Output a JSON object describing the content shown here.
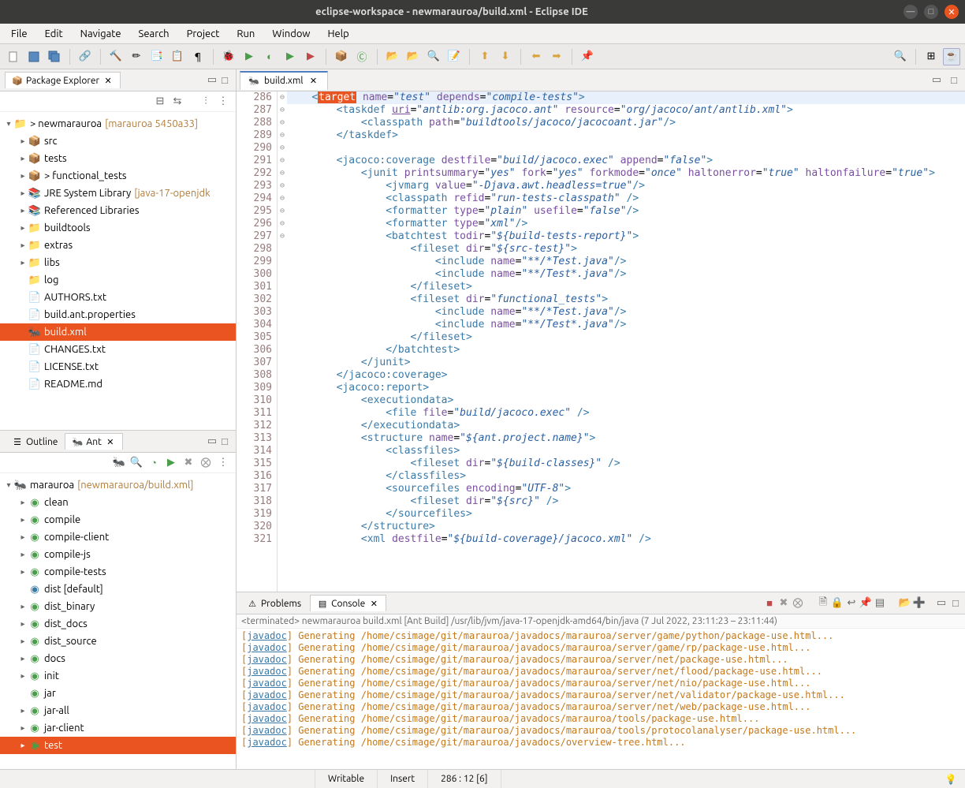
{
  "window": {
    "title": "eclipse-workspace - newmarauroa/build.xml - Eclipse IDE"
  },
  "menu": [
    "File",
    "Edit",
    "Navigate",
    "Search",
    "Project",
    "Run",
    "Window",
    "Help"
  ],
  "pkgExplorer": {
    "title": "Package Explorer",
    "project": {
      "name": "> newmarauroa",
      "suffix": "[marauroa 5450a33]"
    },
    "items": [
      {
        "indent": 1,
        "tw": "▸",
        "icon": "pkg",
        "label": "src"
      },
      {
        "indent": 1,
        "tw": "▸",
        "icon": "pkg",
        "label": "tests"
      },
      {
        "indent": 1,
        "tw": "▸",
        "icon": "pkg",
        "label": "> functional_tests"
      },
      {
        "indent": 1,
        "tw": "▸",
        "icon": "jar",
        "label": "JRE System Library",
        "suffix": "[java-17-openjdk"
      },
      {
        "indent": 1,
        "tw": "▸",
        "icon": "jar",
        "label": "Referenced Libraries"
      },
      {
        "indent": 1,
        "tw": "▸",
        "icon": "folder",
        "label": "buildtools"
      },
      {
        "indent": 1,
        "tw": "▸",
        "icon": "folder",
        "label": "extras"
      },
      {
        "indent": 1,
        "tw": "▸",
        "icon": "folder",
        "label": "libs"
      },
      {
        "indent": 1,
        "tw": "",
        "icon": "folder",
        "label": "log"
      },
      {
        "indent": 1,
        "tw": "",
        "icon": "file",
        "label": "AUTHORS.txt"
      },
      {
        "indent": 1,
        "tw": "",
        "icon": "file",
        "label": "build.ant.properties"
      },
      {
        "indent": 1,
        "tw": "",
        "icon": "ant",
        "label": "build.xml",
        "selected": true
      },
      {
        "indent": 1,
        "tw": "",
        "icon": "file",
        "label": "CHANGES.txt"
      },
      {
        "indent": 1,
        "tw": "",
        "icon": "file",
        "label": "LICENSE.txt"
      },
      {
        "indent": 1,
        "tw": "",
        "icon": "file",
        "label": "README.md"
      }
    ]
  },
  "outline": {
    "tab1": "Outline",
    "tab2": "Ant"
  },
  "ant": {
    "root": {
      "name": "marauroa",
      "suffix": "[newmarauroa/build.xml]"
    },
    "targets": [
      "clean",
      "compile",
      "compile-client",
      "compile-js",
      "compile-tests",
      "dist [default]",
      "dist_binary",
      "dist_docs",
      "dist_source",
      "docs",
      "init",
      "jar",
      "jar-all",
      "jar-client",
      "test"
    ],
    "selectedTarget": "test"
  },
  "editor": {
    "file": "build.xml",
    "startLine": 286,
    "lines": [
      {
        "n": 286,
        "fold": "⊖",
        "current": true,
        "html": "    <span class='tagc'>&lt;</span><span class='hl-target'>target</span> <span class='attr'>name</span>=<span class='val'>\"test\"</span> <span class='attr'>depends</span>=<span class='val'>\"compile-tests\"</span><span class='tagc'>&gt;</span>"
      },
      {
        "n": 287,
        "fold": "⊖",
        "html": "        <span class='tagc'>&lt;taskdef</span> <span class='attr'><u>uri</u></span>=<span class='val'>\"antlib:org.jacoco.ant\"</span> <span class='attr'>resource</span>=<span class='val'>\"org/jacoco/ant/antlib.xml\"</span><span class='tagc'>&gt;</span>"
      },
      {
        "n": 288,
        "fold": "",
        "html": "            <span class='tagc'>&lt;classpath</span> <span class='attr'>path</span>=<span class='val'>\"buildtools/jacoco/jacocoant.jar\"</span><span class='tagc'>/&gt;</span>"
      },
      {
        "n": 289,
        "fold": "",
        "html": "        <span class='tagc'>&lt;/taskdef&gt;</span>"
      },
      {
        "n": 290,
        "fold": "",
        "html": ""
      },
      {
        "n": 291,
        "fold": "⊖",
        "html": "        <span class='tagc'>&lt;jacoco:coverage</span> <span class='attr'>destfile</span>=<span class='val'>\"build/jacoco.exec\"</span> <span class='attr'>append</span>=<span class='val'>\"false\"</span><span class='tagc'>&gt;</span>"
      },
      {
        "n": 292,
        "fold": "⊖",
        "html": "            <span class='tagc'>&lt;junit</span> <span class='attr'>printsummary</span>=<span class='val'>\"yes\"</span> <span class='attr'>fork</span>=<span class='val'>\"yes\"</span> <span class='attr'>forkmode</span>=<span class='val'>\"once\"</span> <span class='attr'>haltonerror</span>=<span class='val'>\"true\"</span> <span class='attr'>haltonfailure</span>=<span class='val'>\"true\"</span><span class='tagc'>&gt;</span>"
      },
      {
        "n": 293,
        "fold": "",
        "html": "                <span class='tagc'>&lt;jvmarg</span> <span class='attr'>value</span>=<span class='val'>\"-Djava.awt.headless=true\"</span><span class='tagc'>/&gt;</span>"
      },
      {
        "n": 294,
        "fold": "",
        "html": "                <span class='tagc'>&lt;classpath</span> <span class='attr'>refid</span>=<span class='val'>\"run-tests-classpath\"</span> <span class='tagc'>/&gt;</span>"
      },
      {
        "n": 295,
        "fold": "",
        "html": "                <span class='tagc'>&lt;formatter</span> <span class='attr'>type</span>=<span class='val'>\"plain\"</span> <span class='attr'>usefile</span>=<span class='val'>\"false\"</span><span class='tagc'>/&gt;</span>"
      },
      {
        "n": 296,
        "fold": "",
        "html": "                <span class='tagc'>&lt;formatter</span> <span class='attr'>type</span>=<span class='val'>\"xml\"</span><span class='tagc'>/&gt;</span>"
      },
      {
        "n": 297,
        "fold": "⊖",
        "html": "                <span class='tagc'>&lt;batchtest</span> <span class='attr'>todir</span>=<span class='val'>\"${build-tests-report}\"</span><span class='tagc'>&gt;</span>"
      },
      {
        "n": 298,
        "fold": "⊖",
        "html": "                    <span class='tagc'>&lt;fileset</span> <span class='attr'>dir</span>=<span class='val'>\"${src-test}\"</span><span class='tagc'>&gt;</span>"
      },
      {
        "n": 299,
        "fold": "",
        "html": "                        <span class='tagc'>&lt;include</span> <span class='attr'>name</span>=<span class='val'>\"**/*Test.java\"</span><span class='tagc'>/&gt;</span>"
      },
      {
        "n": 300,
        "fold": "",
        "html": "                        <span class='tagc'>&lt;include</span> <span class='attr'>name</span>=<span class='val'>\"**/Test*.java\"</span><span class='tagc'>/&gt;</span>"
      },
      {
        "n": 301,
        "fold": "",
        "html": "                    <span class='tagc'>&lt;/fileset&gt;</span>"
      },
      {
        "n": 302,
        "fold": "⊖",
        "html": "                    <span class='tagc'>&lt;fileset</span> <span class='attr'>dir</span>=<span class='val'>\"functional_tests\"</span><span class='tagc'>&gt;</span>"
      },
      {
        "n": 303,
        "fold": "",
        "html": "                        <span class='tagc'>&lt;include</span> <span class='attr'>name</span>=<span class='val'>\"**/*Test.java\"</span><span class='tagc'>/&gt;</span>"
      },
      {
        "n": 304,
        "fold": "",
        "html": "                        <span class='tagc'>&lt;include</span> <span class='attr'>name</span>=<span class='val'>\"**/Test*.java\"</span><span class='tagc'>/&gt;</span>"
      },
      {
        "n": 305,
        "fold": "",
        "html": "                    <span class='tagc'>&lt;/fileset&gt;</span>"
      },
      {
        "n": 306,
        "fold": "",
        "html": "                <span class='tagc'>&lt;/batchtest&gt;</span>"
      },
      {
        "n": 307,
        "fold": "",
        "html": "            <span class='tagc'>&lt;/junit&gt;</span>"
      },
      {
        "n": 308,
        "fold": "",
        "html": "        <span class='tagc'>&lt;/jacoco:coverage&gt;</span>"
      },
      {
        "n": 309,
        "fold": "⊖",
        "html": "        <span class='tagc'>&lt;jacoco:report&gt;</span>"
      },
      {
        "n": 310,
        "fold": "⊖",
        "html": "            <span class='tagc'>&lt;executiondata&gt;</span>"
      },
      {
        "n": 311,
        "fold": "",
        "html": "                <span class='tagc'>&lt;file</span> <span class='attr'>file</span>=<span class='val'>\"build/jacoco.exec\"</span> <span class='tagc'>/&gt;</span>"
      },
      {
        "n": 312,
        "fold": "",
        "html": "            <span class='tagc'>&lt;/executiondata&gt;</span>"
      },
      {
        "n": 313,
        "fold": "⊖",
        "html": "            <span class='tagc'>&lt;structure</span> <span class='attr'>name</span>=<span class='val'>\"${ant.project.name}\"</span><span class='tagc'>&gt;</span>"
      },
      {
        "n": 314,
        "fold": "⊖",
        "html": "                <span class='tagc'>&lt;classfiles&gt;</span>"
      },
      {
        "n": 315,
        "fold": "",
        "html": "                    <span class='tagc'>&lt;fileset</span> <span class='attr'>dir</span>=<span class='val'>\"${build-classes}\"</span> <span class='tagc'>/&gt;</span>"
      },
      {
        "n": 316,
        "fold": "",
        "html": "                <span class='tagc'>&lt;/classfiles&gt;</span>"
      },
      {
        "n": 317,
        "fold": "⊖",
        "html": "                <span class='tagc'>&lt;sourcefiles</span> <span class='attr'>encoding</span>=<span class='val'>\"UTF-8\"</span><span class='tagc'>&gt;</span>"
      },
      {
        "n": 318,
        "fold": "",
        "html": "                    <span class='tagc'>&lt;fileset</span> <span class='attr'>dir</span>=<span class='val'>\"${src}\"</span> <span class='tagc'>/&gt;</span>"
      },
      {
        "n": 319,
        "fold": "",
        "html": "                <span class='tagc'>&lt;/sourcefiles&gt;</span>"
      },
      {
        "n": 320,
        "fold": "",
        "html": "            <span class='tagc'>&lt;/structure&gt;</span>"
      },
      {
        "n": 321,
        "fold": "",
        "html": "            <span class='tagc'>&lt;xml</span> <span class='attr'>destfile</span>=<span class='val'>\"${build-coverage}/jacoco.xml\"</span> <span class='tagc'>/&gt;</span>"
      }
    ]
  },
  "console": {
    "tabs": {
      "problems": "Problems",
      "console": "Console"
    },
    "header": "<terminated> newmarauroa build.xml [Ant Build] /usr/lib/jvm/java-17-openjdk-amd64/bin/java (7 Jul 2022, 23:11:23 – 23:11:44)",
    "lines": [
      "  [javadoc] Generating /home/csimage/git/marauroa/javadocs/marauroa/server/game/python/package-use.html...",
      "  [javadoc] Generating /home/csimage/git/marauroa/javadocs/marauroa/server/game/rp/package-use.html...",
      "  [javadoc] Generating /home/csimage/git/marauroa/javadocs/marauroa/server/net/package-use.html...",
      "  [javadoc] Generating /home/csimage/git/marauroa/javadocs/marauroa/server/net/flood/package-use.html...",
      "  [javadoc] Generating /home/csimage/git/marauroa/javadocs/marauroa/server/net/nio/package-use.html...",
      "  [javadoc] Generating /home/csimage/git/marauroa/javadocs/marauroa/server/net/validator/package-use.html...",
      "  [javadoc] Generating /home/csimage/git/marauroa/javadocs/marauroa/server/net/web/package-use.html...",
      "  [javadoc] Generating /home/csimage/git/marauroa/javadocs/marauroa/tools/package-use.html...",
      "  [javadoc] Generating /home/csimage/git/marauroa/javadocs/marauroa/tools/protocolanalyser/package-use.html...",
      "  [javadoc] Generating /home/csimage/git/marauroa/javadocs/overview-tree.html..."
    ]
  },
  "status": {
    "writable": "Writable",
    "mode": "Insert",
    "pos": "286 : 12 [6]"
  }
}
